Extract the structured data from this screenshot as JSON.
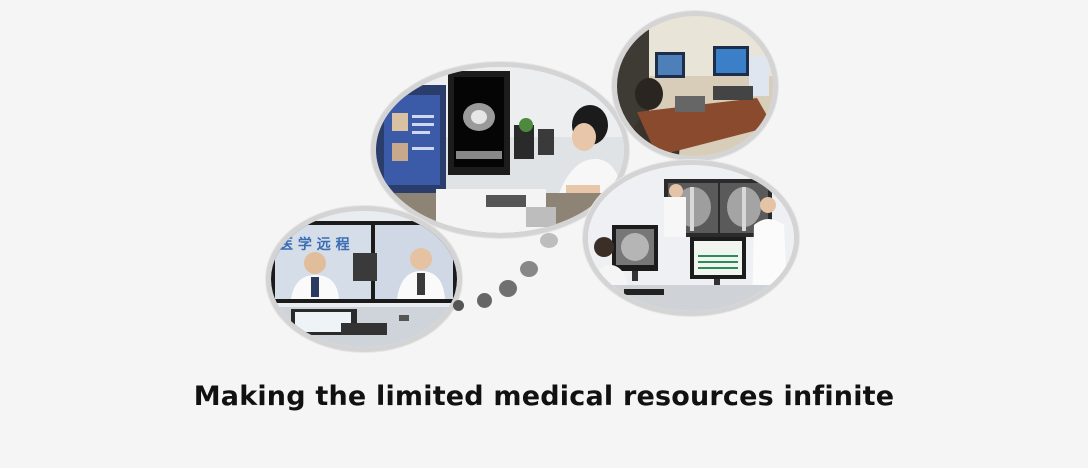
{
  "caption": "Making the limited medical resources infinite",
  "photos": [
    {
      "name": "radiology-workstation-photo"
    },
    {
      "name": "remote-office-photo"
    },
    {
      "name": "xray-review-photo"
    },
    {
      "name": "video-conference-photo",
      "screen_text": "医 学 远 程"
    }
  ],
  "colors": {
    "background": "#f5f5f5",
    "bubble_border": "#d4d4d4",
    "caption": "#111111",
    "thought_dots": [
      "#555555",
      "#666666",
      "#777777",
      "#888888",
      "#aaaaaa",
      "#cccccc"
    ]
  }
}
